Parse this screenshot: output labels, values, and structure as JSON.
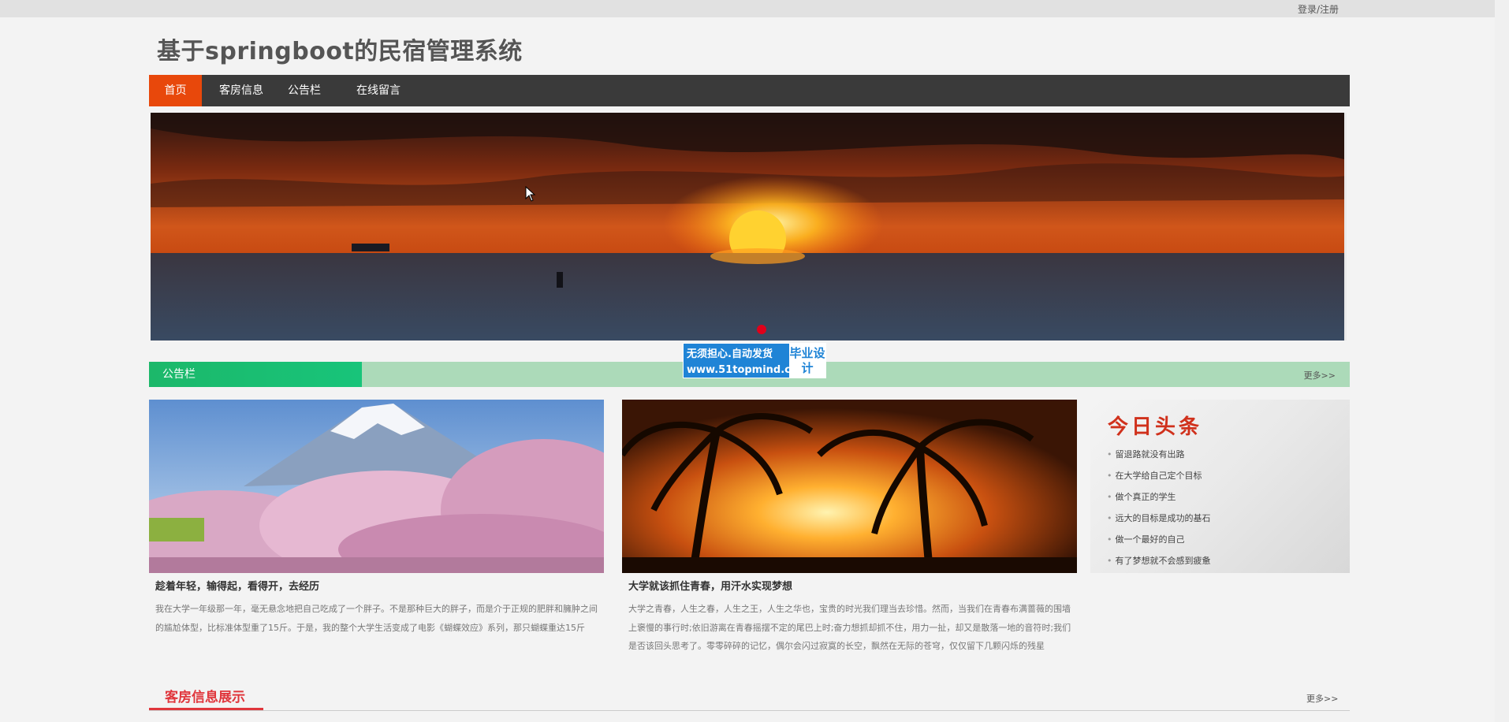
{
  "topbar": {
    "login_label": "登录/注册"
  },
  "site": {
    "title": "基于springboot的民宿管理系统"
  },
  "nav": {
    "items": [
      {
        "label": "首页",
        "active": true
      },
      {
        "label": "客房信息",
        "active": false
      },
      {
        "label": "公告栏",
        "active": false
      },
      {
        "label": "在线留言",
        "active": false
      }
    ],
    "active_color": "#e8480b",
    "bar_color": "#3a3a3a"
  },
  "banner": {
    "image": "sunset-over-sea",
    "slide_index": 1,
    "slide_count": 1
  },
  "notice_bar": {
    "title": "公告栏",
    "more_label": "更多>>"
  },
  "watermark": {
    "line1": "无须担心.自动发货",
    "line2": "www.51topmind.com",
    "badge": "毕业设计"
  },
  "cards": [
    {
      "image": "cherry-blossom-mount-fuji",
      "title": "趁着年轻，输得起，看得开，去经历",
      "text": "我在大学一年级那一年，毫无悬念地把自己吃成了一个胖子。不是那种巨大的胖子，而是介于正规的肥胖和臃肿之间的尴尬体型，比标准体型重了15斤。于是，我的整个大学生活变成了电影《蝴蝶效应》系列，那只蝴蝶重达15斤"
    },
    {
      "image": "palm-trees-sunset",
      "title": "大学就该抓住青春，用汗水实现梦想",
      "text": "大学之青春，人生之春，人生之王，人生之华也，宝贵的时光我们理当去珍惜。然而，当我们在青春布满蔷薇的围墙上褒慢的事行时;依旧游离在青春摇摆不定的尾巴上时;奋力想抓却抓不住，用力一扯，却又是散落一地的音符时;我们是否该回头思考了。零零碎碎的记忆，偶尔会闪过寂寞的长空，飘然在无际的苍穹，仅仅留下几颗闪烁的残星"
    }
  ],
  "headlines": {
    "title": "今日头条",
    "items": [
      "留退路就没有出路",
      "在大学给自己定个目标",
      "做个真正的学生",
      "远大的目标是成功的基石",
      "做一个最好的自己",
      "有了梦想就不会感到疲惫"
    ]
  },
  "room_section": {
    "title": "客房信息展示",
    "more_label": "更多>>"
  },
  "colors": {
    "notice_green": "#1cb86a",
    "section_red": "#e0363c",
    "watermark_blue": "#1f84d6"
  }
}
